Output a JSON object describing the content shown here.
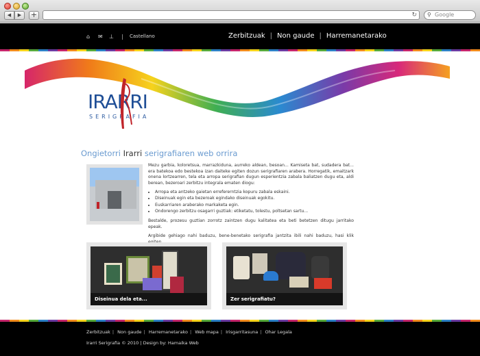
{
  "browser": {
    "nav_back": "◀",
    "nav_forward": "▶",
    "add_tab": "+",
    "search_placeholder": "Google",
    "reload_icon": "reload-icon",
    "search_icon": "search-icon"
  },
  "topbar": {
    "icons": [
      "home-icon",
      "mail-icon",
      "sitemap-icon"
    ],
    "separator": "|",
    "language": "Castellano",
    "nav": [
      "Zerbitzuak",
      "Non gaude",
      "Harremanetarako"
    ]
  },
  "logo": {
    "main": "IRARRI",
    "sub": "SERIGRAFIA"
  },
  "intro": {
    "title_pre": "Ongietorri ",
    "title_brand": "Irarri",
    "title_post": " serigrafiaren web orrira",
    "p1": "Mezu garbia, koloretsua, marrazkiduna, aurreko aldean, besoan... Kamiseta bat, sudadera bat... era batekoa edo bestekoa izan daiteke egiten dozun serigrafiaren arabera. Horregatik, emaitzark onena lortzearren, tela eta arropa serigrafian dugun esperientzia zabala baliatzen dugu eta, aldi berean, bezeroari zerbitzu integrala ematen diogu:",
    "bullets": [
      "Arropa eta antzeko gaietan errefererntzia kopuru zabala eskaini.",
      "Diseinuak egin eta bezeroak egindako diseinuak egokitu.",
      "Euskarriaren araberako markaketa egin.",
      "Ondorengo zerbitzu osagarri guztiak: etiketatu, tolestu, poltsetan sartu..."
    ],
    "p2": "Bestalde, prozesu guztian zorrotz zaintzen dugu kalitatea eta beti betetzen ditugu jarritako epeak.",
    "p3": "Argibide gehiago nahi baduzu, bene-benetako serigrafia jantzita ibili nahi baduzu, hasi klik egiten."
  },
  "cards": [
    {
      "caption": "Diseinua dela eta..."
    },
    {
      "caption": "Zer serigrafiatu?"
    }
  ],
  "footer": {
    "links": [
      "Zerbitzuak",
      "Non gaude",
      "Harremanetarako",
      "Web mapa",
      "Irisgarritasuna",
      "Ohar Legala"
    ],
    "separator": "|",
    "copyright": "Irarri Serigrafia © 2010 | Design by: Hamaika Web"
  },
  "colors": {
    "accent_blue": "#6a9bd0",
    "logo_blue": "#1f4e96",
    "logo_red": "#c0242a"
  }
}
